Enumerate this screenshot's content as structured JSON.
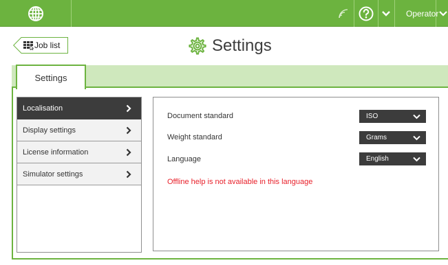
{
  "topbar": {
    "globe_icon": "globe-icon",
    "wifi_icon": "signal-icon",
    "help_icon": "question-circle-icon",
    "operator_icon": "user-badge-icon",
    "operator_label": "Operator"
  },
  "header": {
    "back_label": "Job list",
    "back_icon": "grid-cursor-icon",
    "title_icon": "gear-icon",
    "title": "Settings"
  },
  "tabs": [
    {
      "label": "Settings",
      "active": true
    }
  ],
  "sidebar": {
    "items": [
      {
        "label": "Localisation",
        "active": true
      },
      {
        "label": "Display settings",
        "active": false
      },
      {
        "label": "License information",
        "active": false
      },
      {
        "label": "Simulator settings",
        "active": false
      }
    ]
  },
  "localisation": {
    "rows": [
      {
        "label": "Document standard",
        "value": "ISO"
      },
      {
        "label": "Weight standard",
        "value": "Grams"
      },
      {
        "label": "Language",
        "value": "English"
      }
    ],
    "notice": "Offline help is not available in this language"
  },
  "colors": {
    "brand_green": "#6cb33f",
    "tab_strip": "#cfe8bd",
    "dark": "#3c3c3c",
    "error": "#e8202a"
  }
}
